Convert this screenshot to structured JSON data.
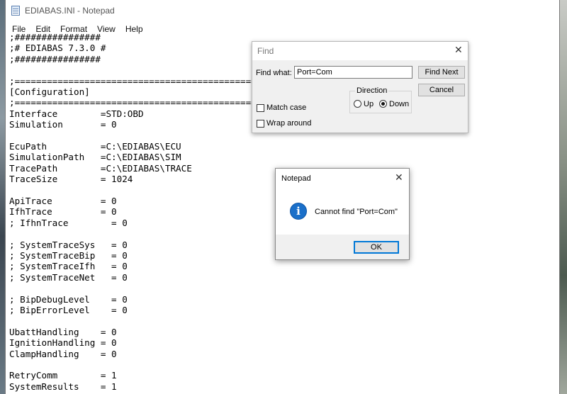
{
  "window": {
    "title": "EDIABAS.INI - Notepad"
  },
  "menu": [
    "File",
    "Edit",
    "Format",
    "View",
    "Help"
  ],
  "editor": {
    "lines": [
      ";################",
      ";# EDIABAS 7.3.0 #",
      ";################",
      "",
      ";====================================================",
      "[Configuration]",
      ";====================================================",
      "Interface        =STD:OBD",
      "Simulation       = 0",
      "",
      "EcuPath          =C:\\EDIABAS\\ECU",
      "SimulationPath   =C:\\EDIABAS\\SIM",
      "TracePath        =C:\\EDIABAS\\TRACE",
      "TraceSize        = 1024",
      "",
      "ApiTrace         = 0",
      "IfhTrace         = 0",
      "; IfhnTrace        = 0",
      "",
      "; SystemTraceSys   = 0",
      "; SystemTraceBip   = 0",
      "; SystemTraceIfh   = 0",
      "; SystemTraceNet   = 0",
      "",
      "; BipDebugLevel    = 0",
      "; BipErrorLevel    = 0",
      "",
      "UbattHandling    = 0",
      "IgnitionHandling = 0",
      "ClampHandling    = 0",
      "",
      "RetryComm        = 1",
      "SystemResults    = 1"
    ]
  },
  "find_dialog": {
    "title": "Find",
    "find_what_label": "Find what:",
    "find_what_value": "Port=Com",
    "find_next": "Find Next",
    "cancel": "Cancel",
    "direction_label": "Direction",
    "up": "Up",
    "down": "Down",
    "direction_selected": "Down",
    "match_case": "Match case",
    "wrap_around": "Wrap around"
  },
  "message_box": {
    "title": "Notepad",
    "message": "Cannot find \"Port=Com\"",
    "ok": "OK",
    "icon": "info-icon"
  }
}
